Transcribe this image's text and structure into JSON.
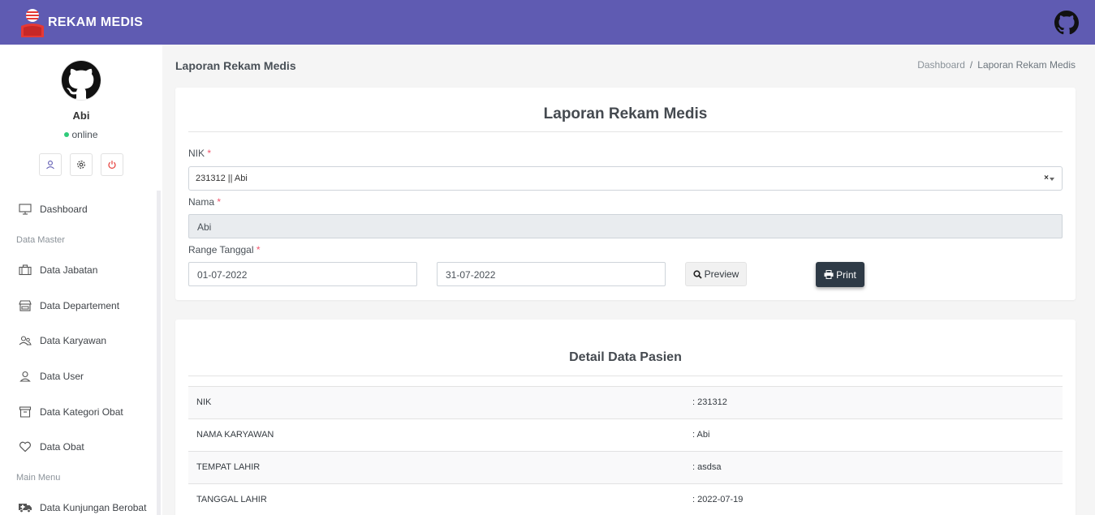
{
  "app": {
    "brand": "REKAM MEDIS",
    "colors": {
      "topbar": "#5f5bb2",
      "print_button": "#2e3a46",
      "required": "#f1556c",
      "online": "#2fcb7a"
    }
  },
  "user": {
    "name": "Abi",
    "status": "online"
  },
  "profile_actions": [
    "user-icon",
    "gear-icon",
    "power-icon"
  ],
  "sidebar": {
    "dashboard": "Dashboard",
    "section_master": "Data Master",
    "jabatan": "Data Jabatan",
    "departement": "Data Departement",
    "karyawan": "Data Karyawan",
    "user": "Data User",
    "kategori_obat": "Data Kategori Obat",
    "obat": "Data Obat",
    "section_main": "Main Menu",
    "kunjungan": "Data Kunjungan Berobat"
  },
  "page": {
    "title": "Laporan Rekam Medis",
    "breadcrumb": {
      "home": "Dashboard",
      "sep": "/",
      "current": "Laporan Rekam Medis"
    }
  },
  "form": {
    "title": "Laporan Rekam Medis",
    "nik_label": "NIK",
    "nik_value": "231312 || Abi",
    "nama_label": "Nama",
    "nama_value": "Abi",
    "range_label": "Range Tanggal",
    "required_mark": "*",
    "date_from": "01-07-2022",
    "date_to": "31-07-2022",
    "clear_glyph": "×",
    "preview_label": "Preview",
    "print_label": "Print"
  },
  "detail": {
    "title": "Detail Data Pasien",
    "rows": [
      {
        "key": "NIK",
        "value": ": 231312"
      },
      {
        "key": "NAMA KARYAWAN",
        "value": ": Abi"
      },
      {
        "key": "TEMPAT LAHIR",
        "value": ": asdsa"
      },
      {
        "key": "TANGGAL LAHIR",
        "value": ": 2022-07-19"
      }
    ]
  }
}
